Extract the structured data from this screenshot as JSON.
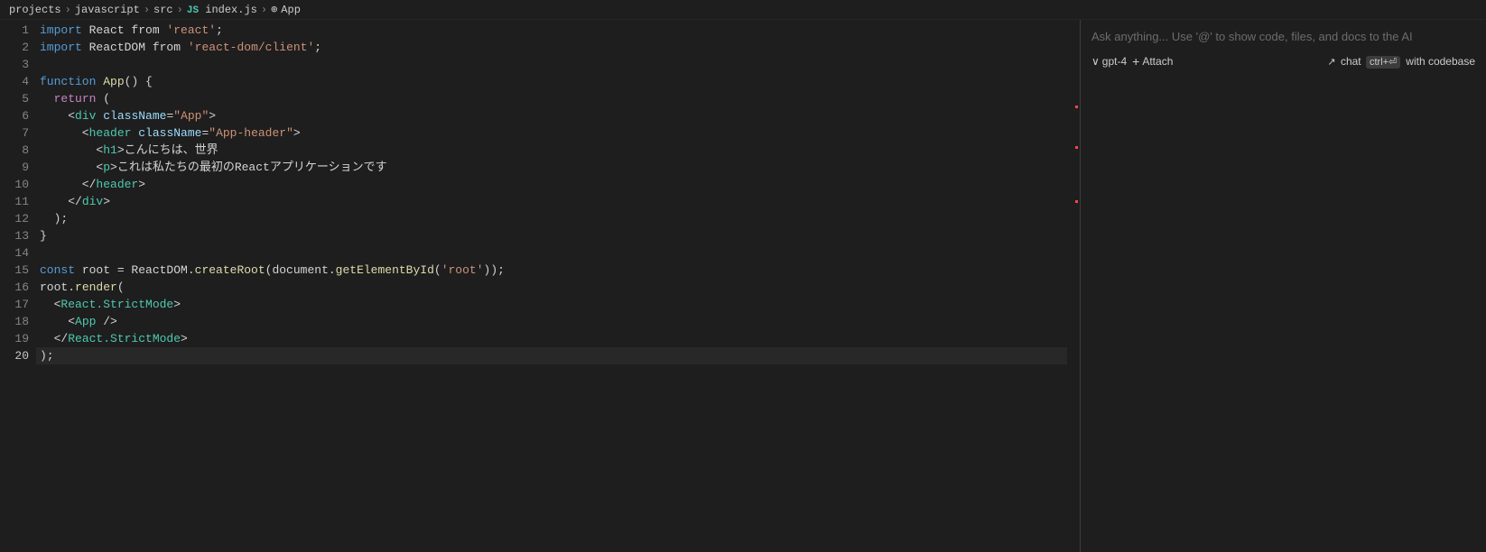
{
  "breadcrumb": {
    "items": [
      "projects",
      "javascript",
      "src",
      "JS index.js",
      "App"
    ]
  },
  "editor": {
    "lines": [
      {
        "num": 1,
        "active": false,
        "tokens": [
          {
            "t": "kw",
            "v": "import"
          },
          {
            "t": "plain",
            "v": " React "
          },
          {
            "t": "plain",
            "v": "from"
          },
          {
            "t": "plain",
            "v": " "
          },
          {
            "t": "str",
            "v": "'react'"
          },
          {
            "t": "plain",
            "v": ";"
          }
        ]
      },
      {
        "num": 2,
        "active": false,
        "tokens": [
          {
            "t": "kw",
            "v": "import"
          },
          {
            "t": "plain",
            "v": " ReactDOM "
          },
          {
            "t": "plain",
            "v": "from"
          },
          {
            "t": "plain",
            "v": " "
          },
          {
            "t": "str",
            "v": "'react-dom/client'"
          },
          {
            "t": "plain",
            "v": ";"
          }
        ]
      },
      {
        "num": 3,
        "active": false,
        "tokens": []
      },
      {
        "num": 4,
        "active": false,
        "tokens": [
          {
            "t": "kw",
            "v": "function"
          },
          {
            "t": "plain",
            "v": " "
          },
          {
            "t": "fn",
            "v": "App"
          },
          {
            "t": "plain",
            "v": "() {"
          }
        ]
      },
      {
        "num": 5,
        "active": false,
        "tokens": [
          {
            "t": "plain",
            "v": "  "
          },
          {
            "t": "kw2",
            "v": "return"
          },
          {
            "t": "plain",
            "v": " ("
          }
        ]
      },
      {
        "num": 6,
        "active": false,
        "tokens": [
          {
            "t": "plain",
            "v": "    <"
          },
          {
            "t": "tag",
            "v": "div"
          },
          {
            "t": "plain",
            "v": " "
          },
          {
            "t": "attr",
            "v": "className"
          },
          {
            "t": "plain",
            "v": "="
          },
          {
            "t": "str",
            "v": "\"App\""
          },
          {
            "t": "plain",
            "v": ">"
          }
        ]
      },
      {
        "num": 7,
        "active": false,
        "tokens": [
          {
            "t": "plain",
            "v": "      <"
          },
          {
            "t": "tag",
            "v": "header"
          },
          {
            "t": "plain",
            "v": " "
          },
          {
            "t": "attr",
            "v": "className"
          },
          {
            "t": "plain",
            "v": "="
          },
          {
            "t": "str",
            "v": "\"App-header\""
          },
          {
            "t": "plain",
            "v": ">"
          }
        ]
      },
      {
        "num": 8,
        "active": false,
        "tokens": [
          {
            "t": "plain",
            "v": "        <"
          },
          {
            "t": "tag",
            "v": "h1"
          },
          {
            "t": "plain",
            "v": ">こんにちは、世界"
          }
        ]
      },
      {
        "num": 9,
        "active": false,
        "tokens": [
          {
            "t": "plain",
            "v": "        <"
          },
          {
            "t": "tag",
            "v": "p"
          },
          {
            "t": "plain",
            "v": ">これは私たちの最初のReactアプリケーションです"
          }
        ]
      },
      {
        "num": 10,
        "active": false,
        "tokens": [
          {
            "t": "plain",
            "v": "      </"
          },
          {
            "t": "tag",
            "v": "header"
          },
          {
            "t": "plain",
            "v": ">"
          }
        ]
      },
      {
        "num": 11,
        "active": false,
        "tokens": [
          {
            "t": "plain",
            "v": "    </"
          },
          {
            "t": "tag",
            "v": "div"
          },
          {
            "t": "plain",
            "v": ">"
          }
        ]
      },
      {
        "num": 12,
        "active": false,
        "tokens": [
          {
            "t": "plain",
            "v": "  );"
          }
        ]
      },
      {
        "num": 13,
        "active": false,
        "tokens": [
          {
            "t": "plain",
            "v": "}"
          }
        ]
      },
      {
        "num": 14,
        "active": false,
        "tokens": []
      },
      {
        "num": 15,
        "active": false,
        "tokens": [
          {
            "t": "kw",
            "v": "const"
          },
          {
            "t": "plain",
            "v": " root = ReactDOM."
          },
          {
            "t": "fn",
            "v": "createRoot"
          },
          {
            "t": "plain",
            "v": "(document."
          },
          {
            "t": "fn",
            "v": "getElementById"
          },
          {
            "t": "plain",
            "v": "("
          },
          {
            "t": "str",
            "v": "'root'"
          },
          {
            "t": "plain",
            "v": "));"
          }
        ]
      },
      {
        "num": 16,
        "active": false,
        "tokens": [
          {
            "t": "plain",
            "v": "root."
          },
          {
            "t": "fn",
            "v": "render"
          },
          {
            "t": "plain",
            "v": "("
          }
        ]
      },
      {
        "num": 17,
        "active": false,
        "tokens": [
          {
            "t": "plain",
            "v": "  <"
          },
          {
            "t": "tag",
            "v": "React.StrictMode"
          },
          {
            "t": "plain",
            "v": ">"
          }
        ]
      },
      {
        "num": 18,
        "active": false,
        "tokens": [
          {
            "t": "plain",
            "v": "    <"
          },
          {
            "t": "tag",
            "v": "App"
          },
          {
            "t": "plain",
            "v": " />"
          }
        ]
      },
      {
        "num": 19,
        "active": false,
        "tokens": [
          {
            "t": "plain",
            "v": "  </"
          },
          {
            "t": "tag",
            "v": "React.StrictMode"
          },
          {
            "t": "plain",
            "v": ">"
          }
        ]
      },
      {
        "num": 20,
        "active": true,
        "tokens": [
          {
            "t": "plain",
            "v": ");"
          }
        ]
      }
    ],
    "scrollMarkers": [
      95,
      140,
      200
    ]
  },
  "ai_panel": {
    "placeholder": "Ask anything... Use '@' to show code, files, and docs to the AI",
    "model_label": "gpt-4",
    "attach_label": "Attach",
    "chat_label": "chat",
    "kbd_shortcut": "ctrl+⏎",
    "codebase_label": "with codebase"
  }
}
